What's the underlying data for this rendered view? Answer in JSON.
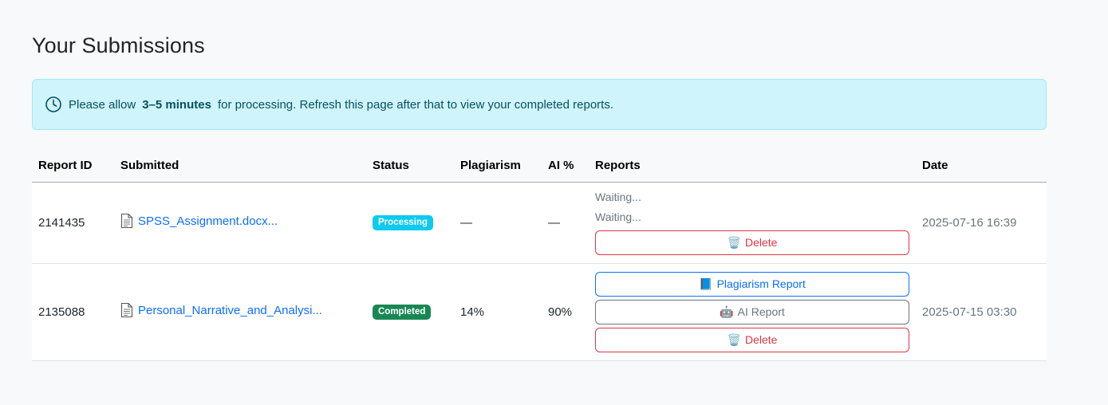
{
  "page": {
    "title": "Your Submissions"
  },
  "alert": {
    "text_before": "Please allow",
    "highlight": "3–5 minutes",
    "text_after": "for processing. Refresh this page after that to view your completed reports.",
    "icon": "clock-icon"
  },
  "table": {
    "headers": [
      "Report ID",
      "Submitted",
      "Status",
      "Plagiarism",
      "AI %",
      "Reports",
      "Date"
    ],
    "rows": [
      {
        "report_id": "2141435",
        "file": "SPSS_Assignment.docx...",
        "status": "Processing",
        "plagiarism": "—",
        "ai": "—",
        "waiting_1": "Waiting...",
        "waiting_2": "Waiting...",
        "delete_label": "Delete",
        "date": "2025-07-16 16:39"
      },
      {
        "report_id": "2135088",
        "file": "Personal_Narrative_and_Analysi...",
        "status": "Completed",
        "plagiarism": "14%",
        "ai": "90%",
        "plagiarism_report_label": "Plagiarism Report",
        "ai_report_label": "AI Report",
        "delete_label": "Delete",
        "date": "2025-07-15 03:30"
      }
    ]
  },
  "colors": {
    "alert_bg": "#cff4fc",
    "link": "#0d6efd",
    "processing": "#0dcaf0",
    "completed": "#198754",
    "danger": "#dc3545"
  }
}
